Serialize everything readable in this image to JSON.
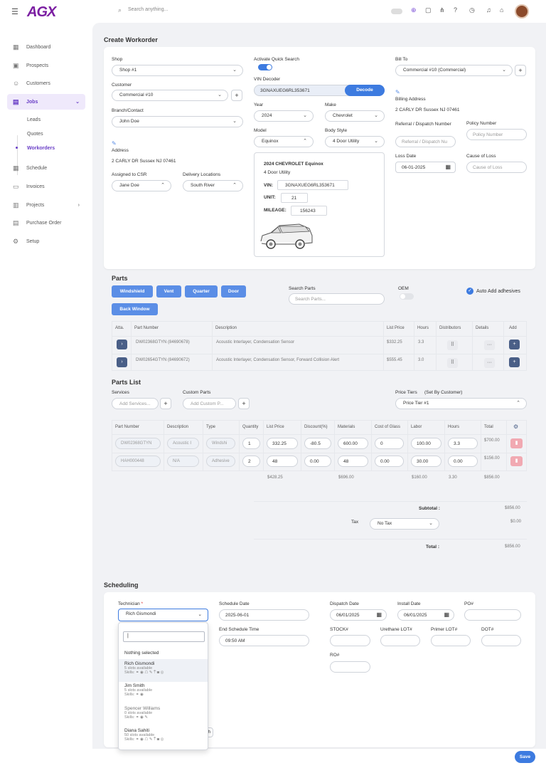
{
  "header": {
    "search_placeholder": "Search anything...",
    "logo": "AGX"
  },
  "sidebar": {
    "items": [
      {
        "label": "Dashboard"
      },
      {
        "label": "Prospects"
      },
      {
        "label": "Customers"
      },
      {
        "label": "Jobs"
      },
      {
        "label": "Schedule"
      },
      {
        "label": "Invoices"
      },
      {
        "label": "Projects"
      },
      {
        "label": "Purchase Order"
      },
      {
        "label": "Setup"
      }
    ],
    "sub": [
      {
        "label": "Leads"
      },
      {
        "label": "Quotes"
      },
      {
        "label": "Workorders"
      }
    ]
  },
  "form": {
    "title": "Create Workorder",
    "shop_label": "Shop",
    "shop_value": "Shop #1",
    "customer_label": "Customer",
    "customer_value": "Commercial #10",
    "branch_label": "Branch/Contact",
    "branch_value": "John Doe",
    "address_label": "Address",
    "address_value": "2 CARLY DR Sussex NJ 07461",
    "csr_label": "Assigned to CSR",
    "csr_value": "Jane Doe",
    "delivery_label": "Delivery Locations",
    "delivery_value": "South River",
    "quick_search_label": "Activate Quick Search",
    "vin_label": "VIN Decoder",
    "vin_value": "3GNAXUEG6RL353671",
    "decode_label": "Decode",
    "year_label": "Year",
    "year_value": "2024",
    "make_label": "Make",
    "make_value": "Chevrolet",
    "model_label": "Model",
    "model_value": "Equinox",
    "body_label": "Body Style",
    "body_value": "4 Door Utility",
    "vehicle_title": "2024 CHEVROLET Equinox",
    "vehicle_sub": "4 Door Utility",
    "vin_key": "VIN:",
    "vin_box": "3GNAXUEG6RL353671",
    "unit_key": "UNIT:",
    "unit_value": "21",
    "mileage_key": "MILEAGE:",
    "mileage_value": "156243",
    "bill_label": "Bill To",
    "bill_value": "Commercial #10 (Commercial)",
    "billing_address_label": "Billing Address",
    "billing_address_value": "2 CARLY DR Sussex NJ 07461",
    "referral_label": "Referral / Dispatch Number",
    "referral_placeholder": "Referral / Dispatch Nu",
    "policy_label": "Policy Number",
    "policy_placeholder": "Policy Number",
    "loss_date_label": "Loss Date",
    "loss_date_value": "06-01-2025",
    "cause_label": "Cause of Loss",
    "cause_placeholder": "Cause of Loss"
  },
  "parts": {
    "title": "Parts",
    "buttons": [
      "Windshield",
      "Vent",
      "Quarter",
      "Door",
      "Back Window"
    ],
    "search_label": "Search Parts",
    "search_placeholder": "Search Parts...",
    "oem_label": "OEM",
    "auto_label": "Auto Add adhesives",
    "headers": [
      "Atta.",
      "Part Number",
      "Description",
      "List Price",
      "Hours",
      "Distributors",
      "Details",
      "Add"
    ],
    "rows": [
      {
        "part": "DW02368GTYN (84690678)",
        "desc": "Acoustic Interlayer, Condensation Sensor",
        "price": "$332.25",
        "hours": "3.3"
      },
      {
        "part": "DW02654GTYN (84690672)",
        "desc": "Acoustic Interlayer, Condensation Sensor, Forward Collision Alert",
        "price": "$555.45",
        "hours": "3.0"
      }
    ]
  },
  "parts_list": {
    "title": "Parts List",
    "services_label": "Services",
    "services_placeholder": "Add Services...",
    "custom_label": "Custom Parts",
    "custom_placeholder": "Add Custom P...",
    "tiers_label": "Price Tiers",
    "tiers_note": "(Set By Customer)",
    "tiers_value": "Price Tier #1",
    "headers": [
      "Part Number",
      "Description",
      "Type",
      "Quantity",
      "List Price",
      "Discount(%)",
      "Materials",
      "Cost of Glass",
      "Labor",
      "Hours",
      "Total"
    ],
    "rows": [
      {
        "part": "DW02368GTYN",
        "desc": "Acoustic I",
        "type": "Windshi",
        "qty": "1",
        "price": "332.25",
        "disc": "-80.5",
        "mat": "600.00",
        "glass": "0",
        "labor": "100.00",
        "hours": "3.3",
        "total": "$700.00"
      },
      {
        "part": "HAH000448",
        "desc": "N/A",
        "type": "Adhesive",
        "qty": "2",
        "price": "48",
        "disc": "0.00",
        "mat": "48",
        "glass": "0.00",
        "labor": "30.00",
        "hours": "0.00",
        "total": "$156.00"
      }
    ],
    "totals": {
      "price": "$428.25",
      "mat": "$696.00",
      "labor": "$160.00",
      "hours": "3.30",
      "total": "$856.00"
    },
    "subtotal_label": "Subtotal :",
    "subtotal_value": "$856.00",
    "tax_label": "Tax",
    "tax_value": "No Tax",
    "tax_amount": "$0.00",
    "total_label": "Total :",
    "total_value": "$856.00"
  },
  "scheduling": {
    "title": "Scheduling",
    "tech_label": "Technician",
    "tech_required": "*",
    "tech_value": "Rich Gismondi",
    "sched_date_label": "Schedule Date",
    "sched_date_value": "2025-06-01",
    "end_label": "End Schedule Time",
    "end_value": "09:50 AM",
    "dispatch_label": "Dispatch Date",
    "dispatch_value": "06/01/2025",
    "install_label": "Install Date",
    "install_value": "06/01/2025",
    "po_label": "PO#",
    "stock_label": "STOCK#",
    "urethane_label": "Urethane LOT#",
    "primer_label": "Primer LOT#",
    "dot_label": "DOT#",
    "ro_label": "RO#",
    "dropdown": {
      "nothing": "Nothing selected",
      "techs": [
        {
          "name": "Rich Gismondi",
          "slots": "5 slots available",
          "skills": "Skills:"
        },
        {
          "name": "Jim Smith",
          "slots": "5 slots available",
          "skills": "Skills:"
        },
        {
          "name": "Spencer Williams",
          "slots": "0 slots available",
          "skills": "Skills:"
        },
        {
          "name": "Diana Sahiti",
          "slots": "50 slots available",
          "skills": "Skills:"
        }
      ]
    }
  },
  "save_label": "Save",
  "colors": {
    "accent": "#6a3fc7",
    "blue": "#5b8ee6",
    "dark_btn": "#4a5f87"
  }
}
